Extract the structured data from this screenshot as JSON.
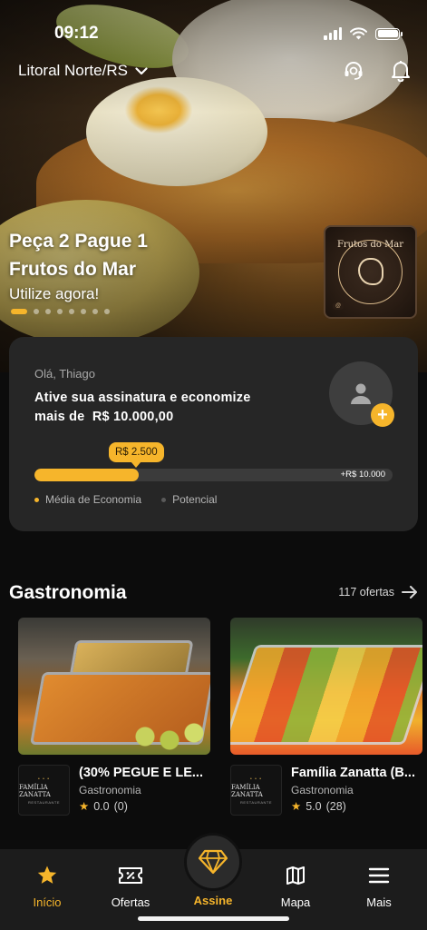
{
  "status_bar": {
    "time": "09:12"
  },
  "header": {
    "region": "Litoral Norte/RS"
  },
  "hero": {
    "title_line1": "Peça 2 Pague 1",
    "title_line2": "Frutos do Mar",
    "subtitle": "Utilize agora!",
    "pagination": {
      "count": 8,
      "active_index": 0
    },
    "partner_logo": {
      "name": "Frutos do Mar"
    }
  },
  "savings_card": {
    "greeting": "Olá, Thiago",
    "cta_line1": "Ative sua assinatura e economize",
    "cta_line2": "mais de  R$ 10.000,00",
    "current_value": "R$ 2.500",
    "max_value": "+R$ 10.000",
    "progress": 0.29,
    "legend": [
      {
        "label": "Média de Economia",
        "color": "#f6b52b"
      },
      {
        "label": "Potencial",
        "color": "#5a5a5a"
      }
    ]
  },
  "section": {
    "title": "Gastronomia",
    "link_label": "117 ofertas"
  },
  "offers": [
    {
      "name": "(30% PEGUE E LE...",
      "category": "Gastronomia",
      "rating": "0.0",
      "reviews": "(0)",
      "logo": {
        "name": "FAMÍLIA ZANATTA",
        "sub": "RESTAURANTE"
      }
    },
    {
      "name": "Família Zanatta (B...",
      "category": "Gastronomia",
      "rating": "5.0",
      "reviews": "(28)",
      "logo": {
        "name": "FAMÍLIA ZANATTA",
        "sub": "RESTAURANTE"
      }
    }
  ],
  "tabbar": {
    "items": [
      {
        "label": "Início",
        "icon": "star-icon",
        "active": true
      },
      {
        "label": "Ofertas",
        "icon": "ticket-icon",
        "active": false
      },
      {
        "label": "Assine",
        "icon": "diamond-icon",
        "active": false
      },
      {
        "label": "Mapa",
        "icon": "map-icon",
        "active": false
      },
      {
        "label": "Mais",
        "icon": "menu-icon",
        "active": false
      }
    ]
  },
  "colors": {
    "accent": "#f6b52b",
    "card_bg": "#262626",
    "page_bg": "#0c0c0c",
    "tabbar_bg": "#1c1c1c"
  }
}
